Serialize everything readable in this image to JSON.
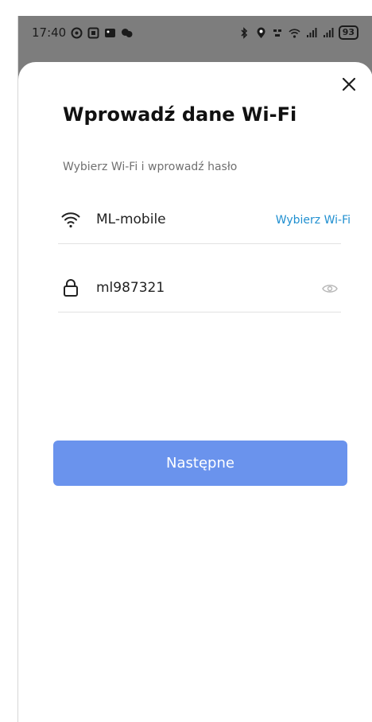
{
  "status_bar": {
    "time": "17:40",
    "battery": "93"
  },
  "dialog": {
    "title": "Wprowadź dane Wi-Fi",
    "subtitle": "Wybierz Wi-Fi i wprowadź hasło",
    "wifi_name": "ML-mobile",
    "choose_wifi_label": "Wybierz Wi-Fi",
    "password_value": "ml987321",
    "next_button_label": "Następne"
  },
  "colors": {
    "accent_link": "#1f8fd0",
    "primary_button": "#6a93ed"
  },
  "icons": {
    "close": "close-icon",
    "wifi": "wifi-icon",
    "lock": "lock-icon",
    "eye": "eye-icon"
  }
}
